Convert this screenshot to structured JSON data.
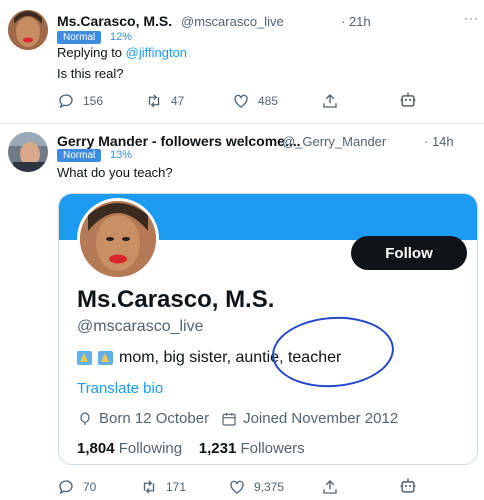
{
  "tweet1": {
    "name": "Ms.Carasco, M.S.",
    "handle": "@mscarasco_live",
    "time": "· 21h",
    "badge": "Normal",
    "percent": "12%",
    "replying_prefix": "Replying to ",
    "replying_to": "@jiffington",
    "text": "Is this real?",
    "stats": {
      "replies": "156",
      "retweets": "47",
      "likes": "485"
    }
  },
  "tweet2": {
    "name": "Gerry Mander - followers welcome....",
    "handle": "@_Gerry_Mander",
    "time": "· 14h",
    "badge": "Normal",
    "percent": "13%",
    "text": "What do you teach?",
    "stats": {
      "replies": "70",
      "retweets": "171",
      "likes": "9,375"
    }
  },
  "card": {
    "follow_label": "Follow",
    "name": "Ms.Carasco, M.S.",
    "handle": "@mscarasco_live",
    "bio": "mom, big sister, auntie, teacher",
    "translate": "Translate bio",
    "born": "Born 12 October",
    "joined": "Joined November 2012",
    "following_count": "1,804",
    "following_label": "Following",
    "followers_count": "1,231",
    "followers_label": "Followers"
  },
  "colors": {
    "accent": "#1d9bf0",
    "badge": "#3e8ce0",
    "annotation": "#2347c8",
    "follow_button": "#0f1419"
  },
  "icons": [
    "reply-icon",
    "retweet-icon",
    "like-icon",
    "share-icon",
    "bot-icon",
    "more-icon",
    "birthday-icon",
    "calendar-icon",
    "flag-icon"
  ]
}
